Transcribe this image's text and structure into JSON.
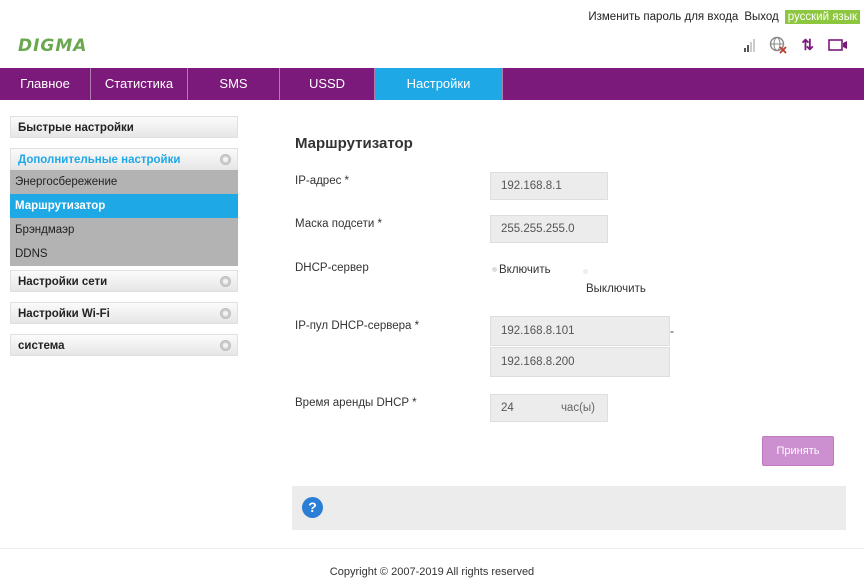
{
  "header": {
    "logo": "DIGMA",
    "change_password": "Изменить пароль для входа",
    "logout": "Выход",
    "language": "русский язык"
  },
  "nav": [
    {
      "label": "Главное"
    },
    {
      "label": "Статистика"
    },
    {
      "label": "SMS"
    },
    {
      "label": "USSD"
    },
    {
      "label": "Настройки",
      "active": true
    }
  ],
  "sidebar": {
    "quick_settings": "Быстрые настройки",
    "advanced_settings": "Дополнительные настройки",
    "advanced_items": [
      {
        "label": "Энергосбережение"
      },
      {
        "label": "Маршрутизатор",
        "active": true
      },
      {
        "label": "Брэндмаэр"
      },
      {
        "label": "DDNS"
      }
    ],
    "network_settings": "Настройки сети",
    "wifi_settings": "Настройки Wi-Fi",
    "system": "система"
  },
  "main": {
    "title": "Маршрутизатор",
    "ip_label": "IP-адрес *",
    "ip_value": "192.168.8.1",
    "mask_label": "Маска подсети *",
    "mask_value": "255.255.255.0",
    "dhcp_label": "DHCP-сервер",
    "dhcp_on": "Включить",
    "dhcp_off": "Выключить",
    "pool_label": "IP-пул DHCP-сервера *",
    "pool_start": "192.168.8.101",
    "pool_end": "192.168.8.200",
    "pool_dash": "-",
    "lease_label": "Время аренды DHCP *",
    "lease_value": "24",
    "lease_unit": "час(ы)",
    "apply": "Принять"
  },
  "help": {
    "icon": "?"
  },
  "footer": {
    "copyright": "Copyright © 2007-2019 All rights reserved"
  },
  "colors": {
    "brand": "#7b1a7b",
    "accent": "#1fa8e6",
    "logo": "#6aa84f",
    "lang_badge": "#8dc63f"
  }
}
